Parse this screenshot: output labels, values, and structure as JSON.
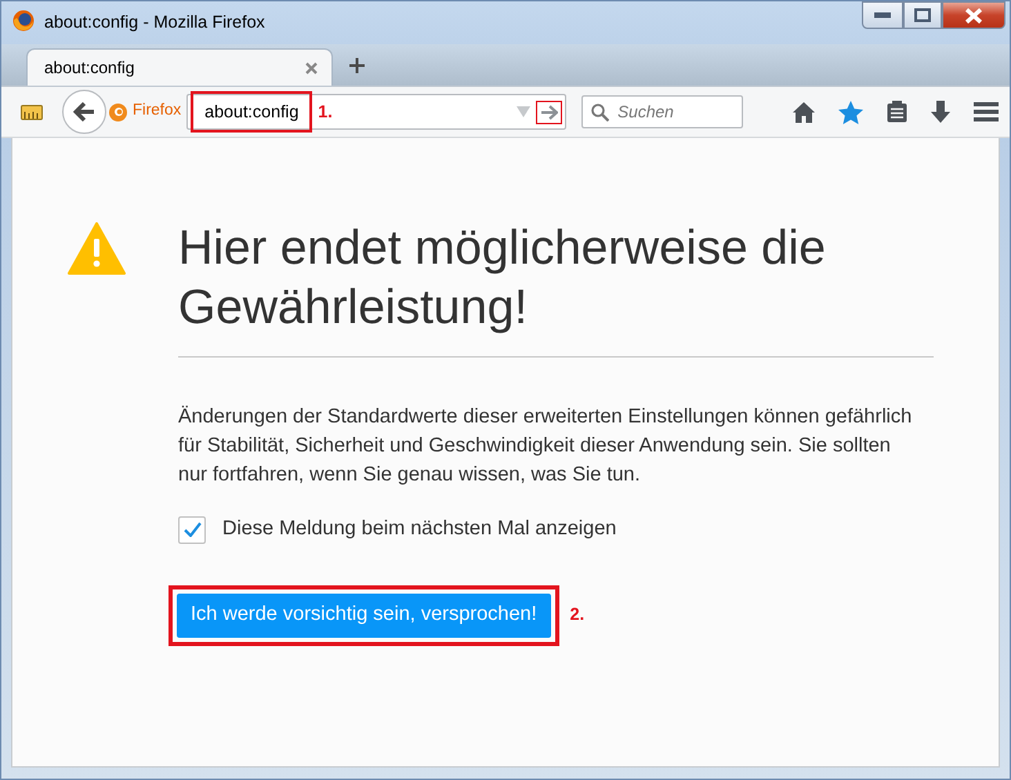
{
  "window": {
    "title": "about:config - Mozilla Firefox"
  },
  "tabs": [
    {
      "label": "about:config",
      "selected": true
    }
  ],
  "address_bar": {
    "identity": "Firefox",
    "url": "about:config",
    "highlighted": true,
    "step": "1.",
    "go_highlighted": true
  },
  "search": {
    "placeholder": "Suchen"
  },
  "warning": {
    "heading": "Hier endet möglicherweise die Gewährleistung!",
    "message": "Änderungen der Standardwerte dieser erweiterten Einstellungen können gefährlich für Stabilität, Sicherheit und Geschwindigkeit dieser Anwendung sein. Sie sollten nur fortfahren, wenn Sie genau wissen, was Sie tun.",
    "checkbox": {
      "label": "Diese Meldung beim nächsten Mal anzeigen",
      "checked": true
    },
    "button": {
      "label": "Ich werde vorsichtig sein, versprochen!",
      "highlighted": true,
      "step": "2."
    }
  }
}
